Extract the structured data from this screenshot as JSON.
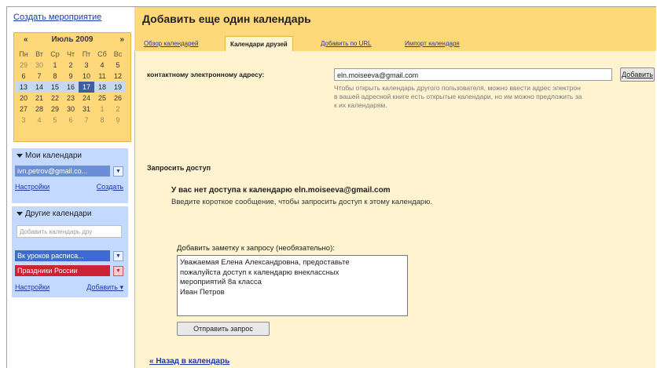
{
  "left": {
    "create_event": "Создать мероприятие",
    "minical": {
      "prev": "«",
      "next": "»",
      "month_title": "Июль 2009",
      "dow": [
        "Пн",
        "Вт",
        "Ср",
        "Чт",
        "Пт",
        "Сб",
        "Вс"
      ],
      "weeks": [
        [
          "29",
          "30",
          "1",
          "2",
          "3",
          "4",
          "5"
        ],
        [
          "6",
          "7",
          "8",
          "9",
          "10",
          "11",
          "12"
        ],
        [
          "13",
          "14",
          "15",
          "16",
          "17",
          "18",
          "19"
        ],
        [
          "20",
          "21",
          "22",
          "23",
          "24",
          "25",
          "26"
        ],
        [
          "27",
          "28",
          "29",
          "30",
          "31",
          "1",
          "2"
        ],
        [
          "3",
          "4",
          "5",
          "6",
          "7",
          "8",
          "9"
        ]
      ]
    },
    "my_calendars": {
      "title": "Мои календари",
      "calendar": "ivn.petrov@gmail.co...",
      "calendar_color": "#6b8fd6",
      "settings": "Настройки",
      "create": "Создать"
    },
    "other_calendars": {
      "title": "Другие календари",
      "add_placeholder": "Добавить календарь дру",
      "items": [
        {
          "label": "Вк уроков расписа...",
          "color": "#3e6bd2"
        },
        {
          "label": "Праздники России",
          "color": "#cc2233"
        }
      ],
      "settings": "Настройки",
      "add": "Добавить ▾"
    }
  },
  "main": {
    "title": "Добавить еще один календарь",
    "tabs": [
      {
        "label": "Обзор календарей"
      },
      {
        "label": "Календари друзей"
      },
      {
        "label": "Добавить по URL"
      },
      {
        "label": "Импорт календаря"
      }
    ],
    "email_label": "контактному электронному адресу:",
    "email_value": "eln.moiseeva@gmail.com",
    "add_button": "Добавить",
    "hint_lines": [
      "Чтобы открыть календарь другого пользователя, можно ввести адрес электрон",
      "в вашей адресной книге есть открытые календари, но им можно предложить за",
      "к их календарям."
    ],
    "request_title": "Запросить доступ",
    "no_access": "У вас нет доступа к календарю eln.moiseeva@gmail.com",
    "no_access_sub": "Введите короткое сообщение, чтобы запросить доступ к этому календарю.",
    "note_label": "Добавить заметку к запросу (необязательно):",
    "note_text": "Уважаемая Елена Александровна, предоставьте\nпожалуйста доступ к календарю внеклассных\nмероприятий 8а класса\nИван Петров",
    "send_button": "Отправить запрос",
    "back_link": "« Назад в календарь"
  }
}
